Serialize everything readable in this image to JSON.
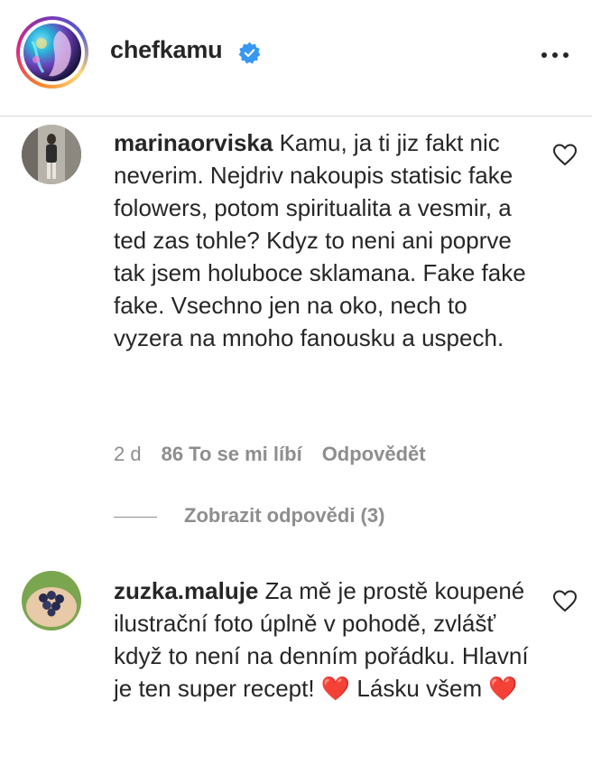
{
  "post": {
    "author": "chefkamu",
    "verified": true,
    "more_icon": "more-horizontal-icon"
  },
  "comments": [
    {
      "username": "marinaorviska",
      "text": "Kamu, ja ti jiz fakt nic neverim. Nejdriv nakoupis statisic fake folowers, potom spiritualita a vesmir, a ted zas tohle? Kdyz to neni ani poprve tak jsem holuboce sklamana. Fake fake fake. Vsechno jen na oko, nech to vyzera na mnoho fanousku a uspech.",
      "age": "2 d",
      "likes": "86 To se mi líbí",
      "reply_label": "Odpovědět",
      "view_replies": "Zobrazit odpovědi (3)"
    },
    {
      "username": "zuzka.maluje",
      "text": "Za mě je prostě koupené ilustrační foto úplně v pohodě, zvlášť když to není na denním pořádku. Hlavní je ten super recept! ❤️ Lásku všem ❤️"
    }
  ],
  "colors": {
    "text": "#262626",
    "muted": "#8e8e8e",
    "verified": "#3897f0",
    "divider": "#dbdbdb"
  }
}
